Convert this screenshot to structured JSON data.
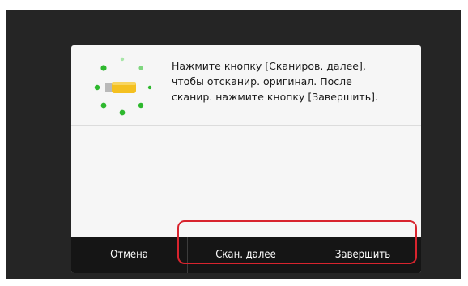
{
  "dialog": {
    "message_lines": [
      "Нажмите кнопку [Сканиров. далее],",
      "чтобы отсканир. оригинал. После",
      "сканир. нажмите кнопку [Завершить]."
    ]
  },
  "buttons": {
    "cancel": "Отмена",
    "scan_next": "Скан. далее",
    "finish": "Завершить"
  },
  "colors": {
    "screen_bg": "#252525",
    "dialog_bg": "#f6f6f6",
    "button_bar": "#151515",
    "highlight": "#d8242e",
    "dot_green": "#2eb82e",
    "usb_yellow": "#f4c020"
  },
  "icons": {
    "status": "scanning-animation-icon"
  }
}
